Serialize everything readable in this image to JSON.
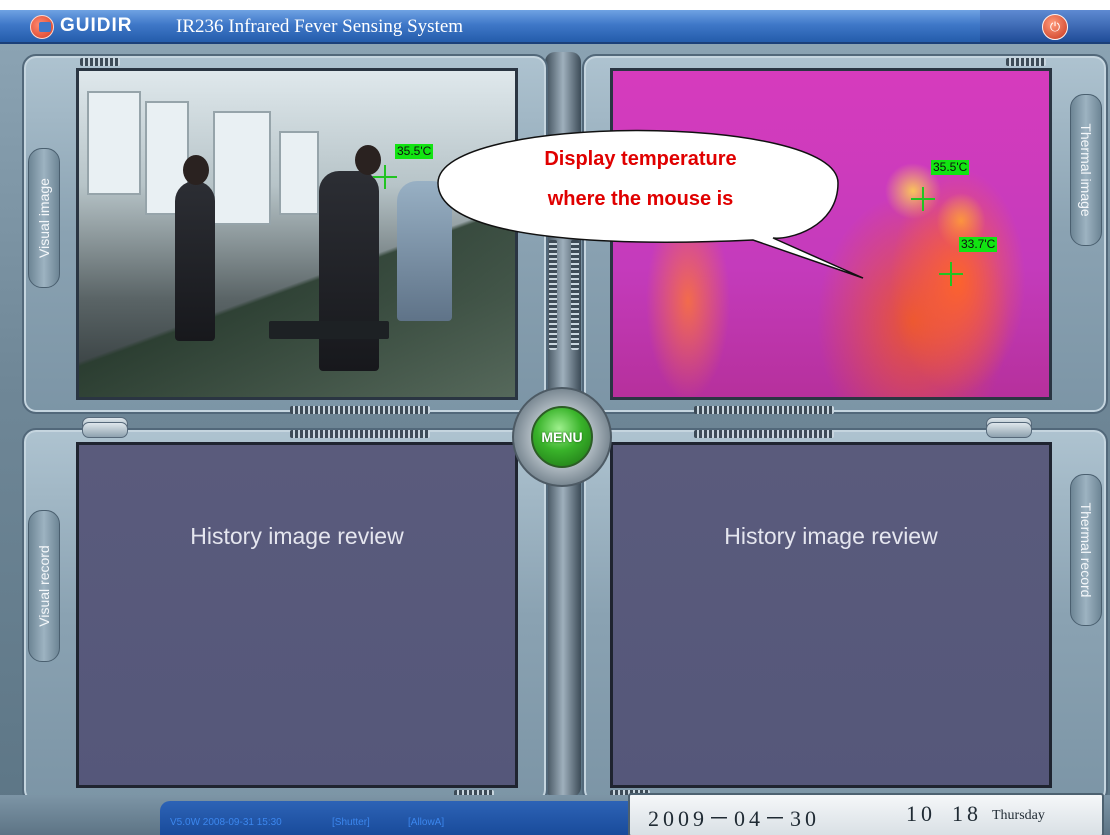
{
  "header": {
    "brand": "GUIDIR",
    "title": "IR236 Infrared Fever Sensing System",
    "power_icon": "power-icon"
  },
  "panels": {
    "visual_image": {
      "tab_label": "Visual image",
      "temperature": "35.5'C"
    },
    "thermal_image": {
      "tab_label": "Thermal image",
      "temperatures": [
        "35.5'C",
        "33.7'C"
      ]
    },
    "visual_record": {
      "tab_label": "Visual record",
      "placeholder": "History image review"
    },
    "thermal_record": {
      "tab_label": "Thermal record",
      "placeholder": "History image review"
    }
  },
  "menu": {
    "label": "MENU"
  },
  "callout": {
    "line1": "Display temperature",
    "line2": "where the mouse is"
  },
  "status": {
    "version": "V5.0W 2008-09-31 15:30",
    "shutter": "[Shutter]",
    "allow": "[AllowA]"
  },
  "clock": {
    "date": "2009－04－30",
    "hour": "10",
    "minute": "18",
    "day": "Thursday"
  },
  "colors": {
    "title_bar": "#3f78c8",
    "temp_label_bg": "#12e412",
    "callout_text": "#e00000",
    "history_bg": "#5a5b7c",
    "menu_button": "#39b32a"
  }
}
